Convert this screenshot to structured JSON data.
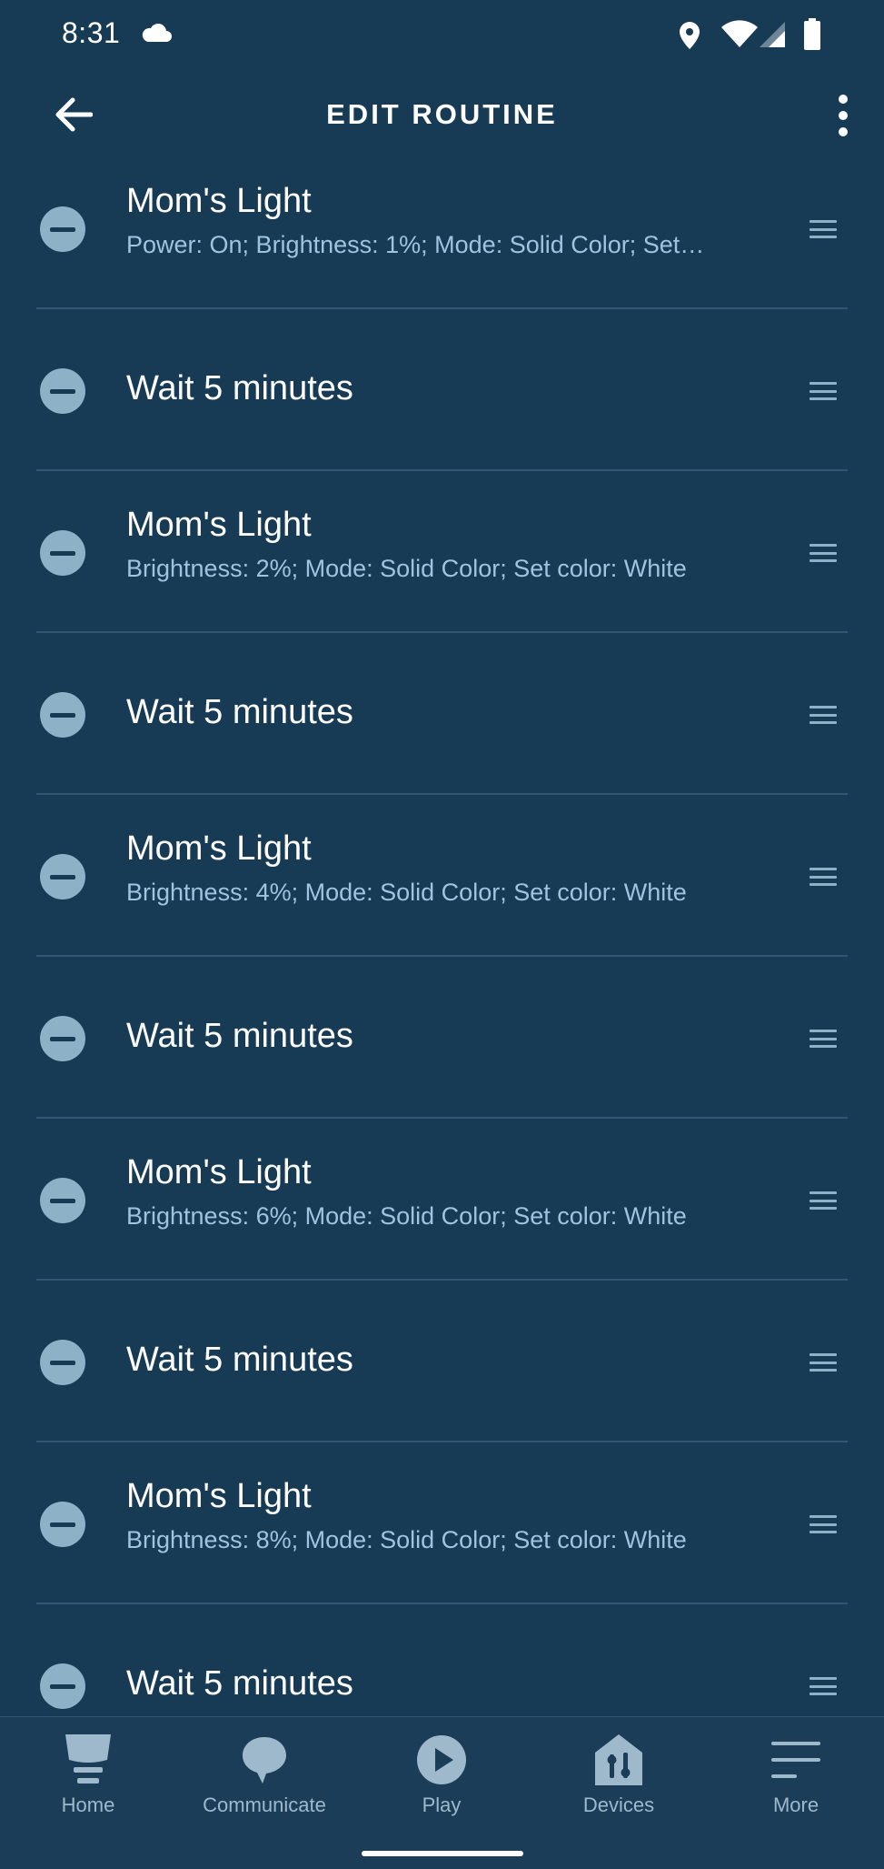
{
  "status_bar": {
    "time": "8:31"
  },
  "app_bar": {
    "title": "EDIT ROUTINE"
  },
  "routine_steps": [
    {
      "title": "Mom's Light",
      "subtitle": "Power: On; Brightness: 1%; Mode: Solid Color; Set…"
    },
    {
      "title": "Wait 5 minutes",
      "subtitle": ""
    },
    {
      "title": "Mom's Light",
      "subtitle": "Brightness: 2%; Mode: Solid Color; Set color: White"
    },
    {
      "title": "Wait 5 minutes",
      "subtitle": ""
    },
    {
      "title": "Mom's Light",
      "subtitle": "Brightness: 4%; Mode: Solid Color; Set color: White"
    },
    {
      "title": "Wait 5 minutes",
      "subtitle": ""
    },
    {
      "title": "Mom's Light",
      "subtitle": "Brightness: 6%; Mode: Solid Color; Set color: White"
    },
    {
      "title": "Wait 5 minutes",
      "subtitle": ""
    },
    {
      "title": "Mom's Light",
      "subtitle": "Brightness: 8%; Mode: Solid Color; Set color: White"
    },
    {
      "title": "Wait 5 minutes",
      "subtitle": ""
    }
  ],
  "bottom_nav": {
    "items": [
      {
        "label": "Home",
        "icon": "home-icon"
      },
      {
        "label": "Communicate",
        "icon": "speech-bubble-icon"
      },
      {
        "label": "Play",
        "icon": "play-icon"
      },
      {
        "label": "Devices",
        "icon": "devices-icon"
      },
      {
        "label": "More",
        "icon": "hamburger-menu-icon"
      }
    ]
  },
  "colors": {
    "background": "#173a55",
    "nav_background": "#1b3d57",
    "divider": "#2f5774",
    "icon_accent": "#8db1c6",
    "subtitle_text": "#9ec4de",
    "nav_label": "#9eb9cc"
  }
}
